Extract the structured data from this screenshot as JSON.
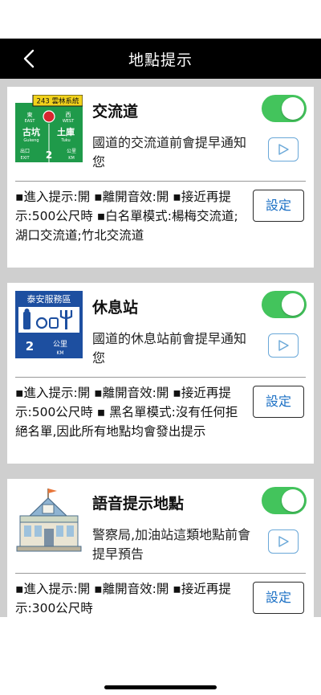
{
  "header": {
    "title": "地點提示"
  },
  "colors": {
    "toggle_on": "#43c45c",
    "settings_text": "#1a6fc4",
    "play_border": "#6aa8d8",
    "navbar_bg": "#000000",
    "content_bg": "#cfcfcf"
  },
  "cards": [
    {
      "title": "交流道",
      "description": "國道的交流道前會提早通知您",
      "settings_summary": "▪進入提示:開 ▪離開音效:開 ▪接近再提示:500公尺時 ▪白名單模式:楊梅交流道;湖口交流道;竹北交流道",
      "settings_label": "設定",
      "enabled": true,
      "icon": "interchange-sign-icon",
      "sign": {
        "route": "243 雲林系統",
        "east_cn": "東",
        "east_en": "EAST",
        "west_cn": "西",
        "west_en": "WEST",
        "left_name": "古坑",
        "left_en": "Gukeng",
        "right_name": "土庫",
        "right_en": "Tuku",
        "exit_label": "出口",
        "exit_en": "EXIT",
        "distance": "2",
        "unit_cn": "公里",
        "unit_en": "KM"
      }
    },
    {
      "title": "休息站",
      "description": "國道的休息站前會提早通知您",
      "settings_summary": "▪進入提示:開 ▪離開音效:開 ▪接近再提示:500公尺時 ▪ 黑名單模式:沒有任何拒絕名單,因此所有地點均會發出提示",
      "settings_label": "設定",
      "enabled": true,
      "icon": "rest-area-sign-icon",
      "sign": {
        "name": "泰安服務區",
        "distance": "2",
        "unit_cn": "公里",
        "unit_en": "KM"
      }
    },
    {
      "title": "語音提示地點",
      "description": "警察局,加油站這類地點前會提早預告",
      "settings_summary": "▪進入提示:開 ▪離開音效:開 ▪接近再提示:300公尺時",
      "settings_label": "設定",
      "enabled": true,
      "icon": "building-icon"
    }
  ]
}
